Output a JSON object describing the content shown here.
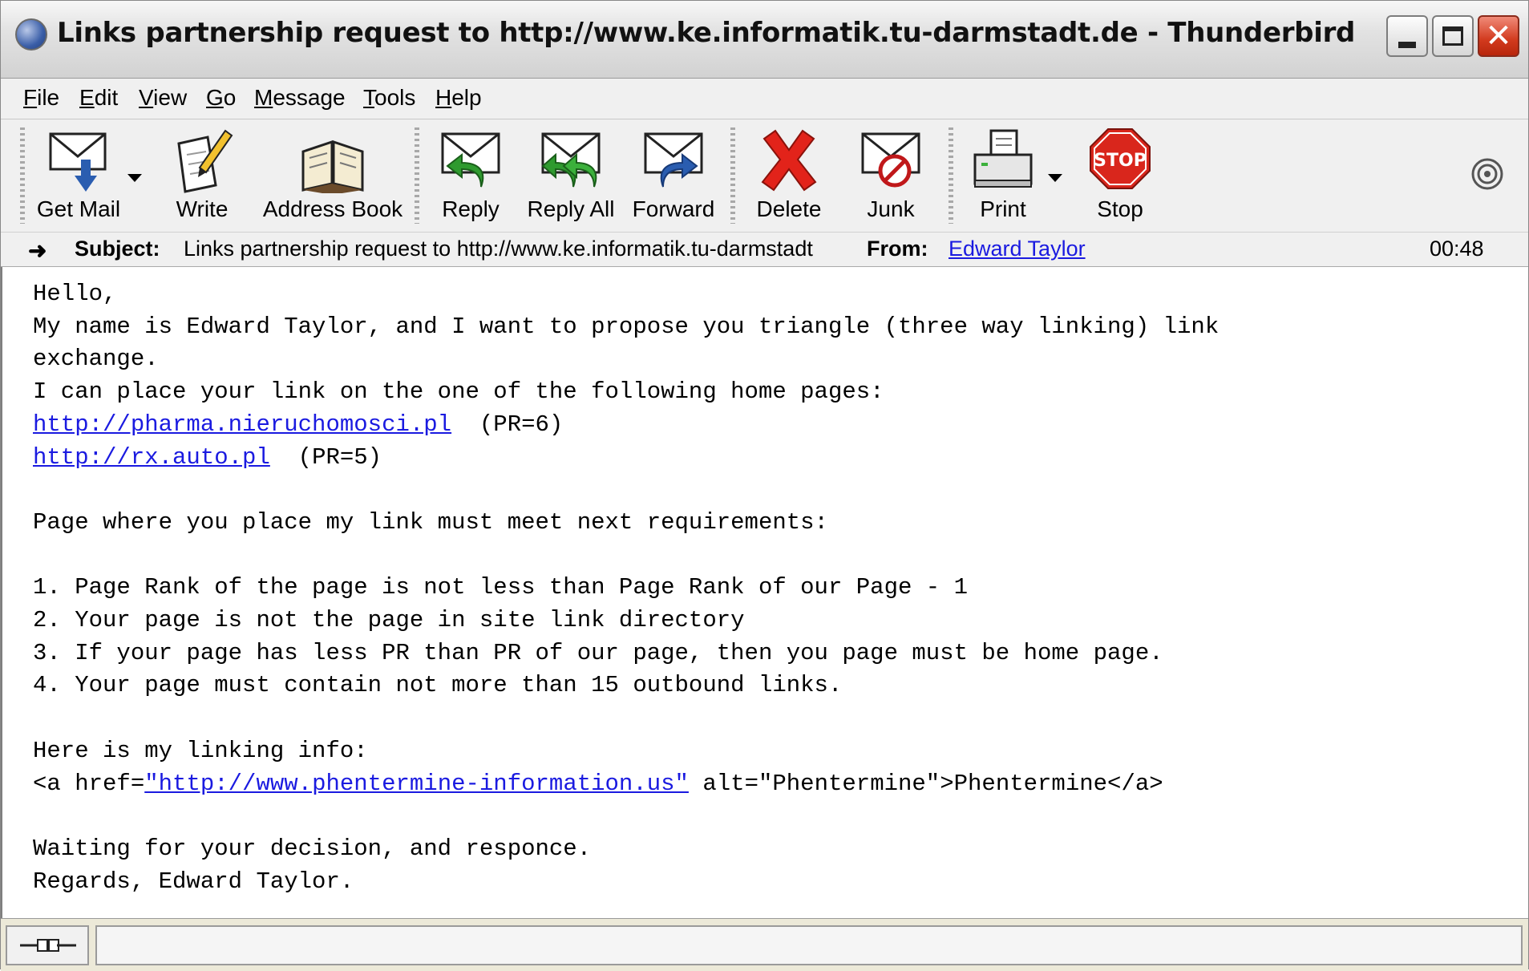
{
  "window": {
    "title": "Links partnership request to http://www.ke.informatik.tu-darmstadt.de - Thunderbird",
    "app_icon": "thunderbird-globe-icon"
  },
  "menu": [
    {
      "ul": "F",
      "rest": "ile"
    },
    {
      "ul": "E",
      "rest": "dit"
    },
    {
      "ul": "V",
      "rest": "iew"
    },
    {
      "ul": "G",
      "rest": "o"
    },
    {
      "ul": "M",
      "rest": "essage"
    },
    {
      "ul": "T",
      "rest": "ools"
    },
    {
      "ul": "H",
      "rest": "elp"
    }
  ],
  "toolbar": {
    "get_mail": "Get Mail",
    "write": "Write",
    "address_book": "Address Book",
    "reply": "Reply",
    "reply_all": "Reply All",
    "forward": "Forward",
    "delete": "Delete",
    "junk": "Junk",
    "print": "Print",
    "stop": "Stop",
    "stop_sign_text": "STOP"
  },
  "header": {
    "subject_label": "Subject:",
    "subject": "Links partnership request to http://www.ke.informatik.tu-darmstadt",
    "from_label": "From:",
    "from": "Edward Taylor",
    "date": "00:48"
  },
  "body": {
    "l1": "Hello,",
    "l2": "My name is Edward Taylor, and I want to propose you triangle (three way linking) link",
    "l3": "exchange.",
    "l4": "I can place your link on the one of the following home pages:",
    "link1": "http://pharma.nieruchomosci.pl",
    "link1_suffix": "  (PR=6)",
    "link2": "http://rx.auto.pl",
    "link2_suffix": "  (PR=5)",
    "l7": "",
    "l8": "Page where you place my link must meet next requirements:",
    "l9": "",
    "l10": "1. Page Rank of the page is not less than Page Rank of our Page - 1",
    "l11": "2. Your page is not the page in site link directory",
    "l12": "3. If your page has less PR than PR of our page, then you page must be home page.",
    "l13": "4. Your page must contain not more than 15 outbound links.",
    "l14": "",
    "l15": "Here is my linking info:",
    "l16_prefix": "<a href=",
    "l16_link": "\"http://www.phentermine-information.us\"",
    "l16_suffix": " alt=\"Phentermine\">Phentermine</a>",
    "l17": "",
    "l18": "Waiting for your decision, and responce.",
    "l19": "Regards, Edward Taylor."
  },
  "status": {
    "text": "",
    "online_icon": "online-plug-icon"
  }
}
